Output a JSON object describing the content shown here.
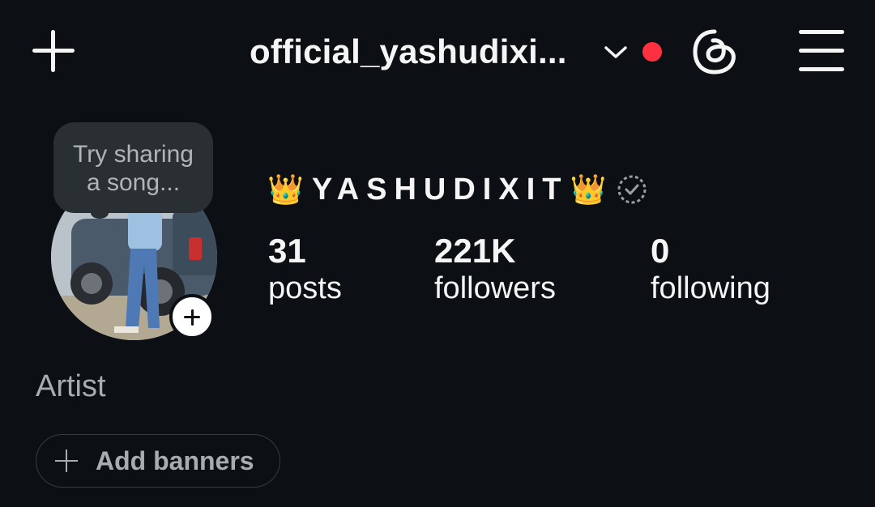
{
  "header": {
    "username": "official_yashudixi...",
    "notification_color": "#ff3040",
    "icons": [
      "plus-icon",
      "chevron-down-icon",
      "threads-icon",
      "menu-icon"
    ]
  },
  "note": {
    "line1": "Try sharing",
    "line2": "a song..."
  },
  "profile": {
    "crown_left": "👑",
    "display_name": "YASHUDIXIT",
    "crown_right": "👑",
    "stats": {
      "posts": {
        "value": "31",
        "label": "posts"
      },
      "followers": {
        "value": "221K",
        "label": "followers"
      },
      "following": {
        "value": "0",
        "label": "following"
      }
    },
    "category": "Artist"
  },
  "actions": {
    "add_banners": "Add banners"
  },
  "colors": {
    "background": "#0c1014",
    "text": "#f5f5f5",
    "muted": "#a8acb0"
  }
}
